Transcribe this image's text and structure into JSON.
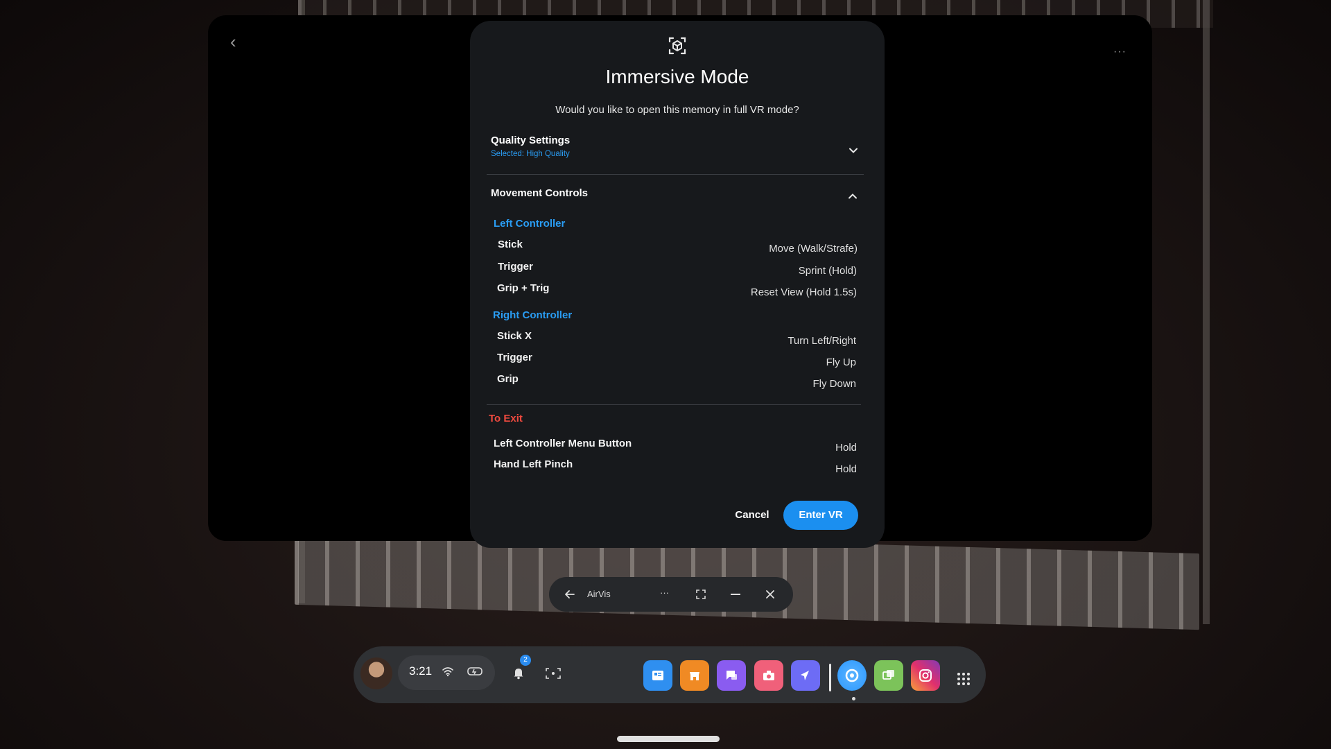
{
  "app_window": {
    "more_label": "···"
  },
  "modal": {
    "icon": "immersive-icon",
    "title": "Immersive Mode",
    "subtitle": "Would you like to open this memory in full VR mode?",
    "quality": {
      "title": "Quality Settings",
      "selected": "Selected: High Quality"
    },
    "movement": {
      "title": "Movement Controls",
      "left_label": "Left Controller",
      "left_rows": [
        {
          "key": "Stick",
          "value": "Move (Walk/Strafe)"
        },
        {
          "key": "Trigger",
          "value": "Sprint (Hold)"
        },
        {
          "key": "Grip + Trig",
          "value": "Reset View (Hold 1.5s)"
        }
      ],
      "right_label": "Right Controller",
      "right_rows": [
        {
          "key": "Stick X",
          "value": "Turn Left/Right"
        },
        {
          "key": "Trigger",
          "value": "Fly Up"
        },
        {
          "key": "Grip",
          "value": "Fly Down"
        }
      ]
    },
    "exit": {
      "label": "To Exit",
      "rows": [
        {
          "key": "Left Controller Menu Button",
          "value": "Hold"
        },
        {
          "key": "Hand Left Pinch",
          "value": "Hold"
        }
      ]
    },
    "cancel_label": "Cancel",
    "enter_label": "Enter VR"
  },
  "window_bar": {
    "app_name": "AirVis",
    "more_label": "···"
  },
  "dock": {
    "time": "3:21",
    "notification_count": "2",
    "apps": [
      {
        "icon": "browser-icon",
        "color": "#2f8ff0"
      },
      {
        "icon": "store-icon",
        "color": "#f08a24"
      },
      {
        "icon": "messages-icon",
        "color": "#8a5cf0"
      },
      {
        "icon": "camera-icon",
        "color": "#f0607a"
      },
      {
        "icon": "explore-icon",
        "color": "#6d6cf5"
      },
      {
        "icon": "airvis-icon",
        "color": "#3aa0ff"
      },
      {
        "icon": "gallery-icon",
        "color": "#7cc35a"
      },
      {
        "icon": "instagram-icon",
        "color": "#e1306c"
      }
    ]
  }
}
